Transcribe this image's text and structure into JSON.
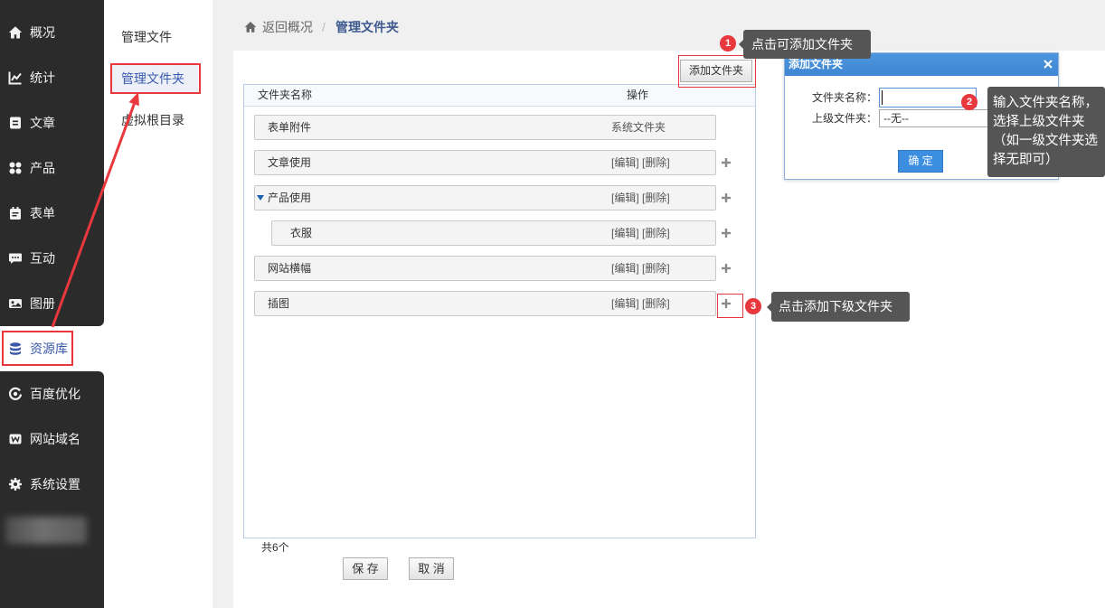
{
  "colors": {
    "sidebar_bg": "#2b2b2b",
    "active_text": "#3a57a8",
    "annotation_red": "#e8383d",
    "tooltip_bg": "#555555",
    "dialog_title_bg": "#3f86d3",
    "confirm_button_bg": "#3c8fe0",
    "table_border": "#b9cde5"
  },
  "sidebar": {
    "items": [
      {
        "icon": "home-icon",
        "label": "概况"
      },
      {
        "icon": "statistics-icon",
        "label": "统计"
      },
      {
        "icon": "article-icon",
        "label": "文章"
      },
      {
        "icon": "product-grid-icon",
        "label": "产品"
      },
      {
        "icon": "form-icon",
        "label": "表单"
      },
      {
        "icon": "chat-bubble-icon",
        "label": "互动"
      },
      {
        "icon": "album-icon",
        "label": "图册"
      },
      {
        "icon": "database-icon",
        "label": "资源库",
        "active": true
      },
      {
        "icon": "baidu-seo-icon",
        "label": "百度优化"
      },
      {
        "icon": "domain-icon",
        "label": "网站域名"
      },
      {
        "icon": "gear-icon",
        "label": "系统设置"
      }
    ]
  },
  "submenu": {
    "items": [
      {
        "label": "管理文件"
      },
      {
        "label": "管理文件夹",
        "active": true
      },
      {
        "label": "虚拟根目录"
      }
    ]
  },
  "breadcrumb": {
    "back_label": "返回概况",
    "separator": "/",
    "current": "管理文件夹"
  },
  "toolbar": {
    "add_folder_label": "添加文件夹"
  },
  "folder_table": {
    "columns": {
      "name": "文件夹名称",
      "actions": "操作"
    },
    "rows": [
      {
        "name": "表单附件",
        "level": 0,
        "system_label": "系统文件夹"
      },
      {
        "name": "文章使用",
        "level": 0,
        "edit_label": "[编辑]",
        "delete_label": "[删除]"
      },
      {
        "name": "产品使用",
        "level": 0,
        "expanded": true,
        "edit_label": "[编辑]",
        "delete_label": "[删除]"
      },
      {
        "name": "衣服",
        "level": 1,
        "edit_label": "[编辑]",
        "delete_label": "[删除]"
      },
      {
        "name": "网站横幅",
        "level": 0,
        "edit_label": "[编辑]",
        "delete_label": "[删除]"
      },
      {
        "name": "插图",
        "level": 0,
        "edit_label": "[编辑]",
        "delete_label": "[删除]"
      }
    ],
    "count_label": "共6个"
  },
  "footer": {
    "save_label": "保 存",
    "cancel_label": "取 消"
  },
  "dialog": {
    "title": "添加文件夹",
    "name_label": "文件夹名称：",
    "parent_label": "上级文件夹：",
    "parent_selected": "--无--",
    "confirm_label": "确 定"
  },
  "annotations": [
    {
      "number": "1",
      "text": "点击可添加文件夹"
    },
    {
      "number": "2",
      "text": "输入文件夹名称，选择上级文件夹（如一级文件夹选择无即可）"
    },
    {
      "number": "3",
      "text": "点击添加下级文件夹"
    }
  ]
}
